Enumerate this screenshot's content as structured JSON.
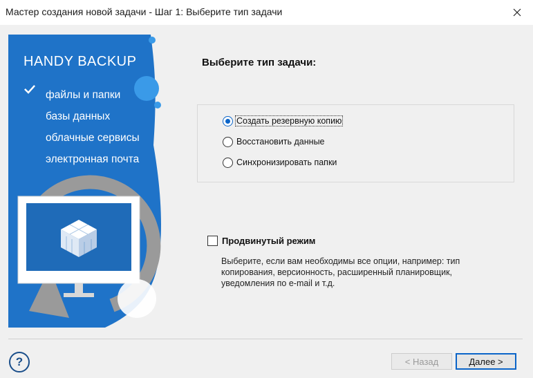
{
  "window": {
    "title": "Мастер создания новой задачи - Шаг 1: Выберите тип задачи"
  },
  "banner": {
    "brand": "HANDY BACKUP",
    "features": [
      "файлы и папки",
      "базы данных",
      "облачные сервисы",
      "электронная почта"
    ]
  },
  "main": {
    "heading": "Выберите тип задачи:",
    "task_types": [
      {
        "label": "Создать резервную копию",
        "checked": true
      },
      {
        "label": "Восстановить данные",
        "checked": false
      },
      {
        "label": "Синхронизировать папки",
        "checked": false
      }
    ],
    "advanced": {
      "label": "Продвинутый режим",
      "checked": false,
      "description": "Выберите, если вам необходимы все опции, например: тип копирования, версионность, расширенный планировщик, уведомления по e-mail и т.д."
    }
  },
  "footer": {
    "help": "?",
    "back_label": "< Назад",
    "next_label": "Далее >"
  },
  "colors": {
    "banner_blue": "#1f73c8",
    "accent": "#0a64c8"
  }
}
